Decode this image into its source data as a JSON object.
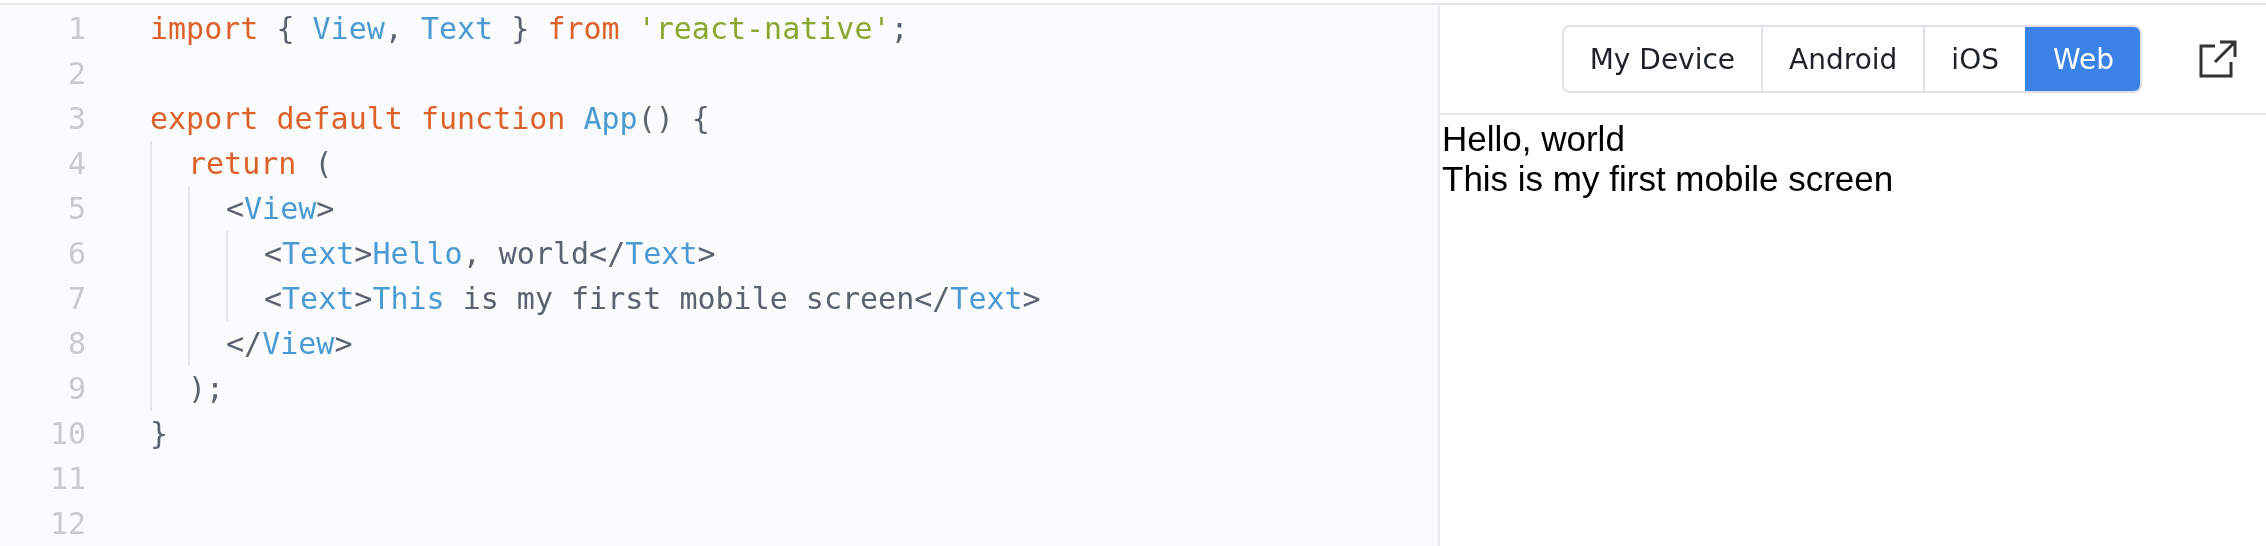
{
  "editor": {
    "lines": [
      {
        "number": "1",
        "tokens": [
          {
            "kind": "keyword",
            "text": "import"
          },
          {
            "kind": "plain",
            "text": " { "
          },
          {
            "kind": "ident",
            "text": "View"
          },
          {
            "kind": "plain",
            "text": ", "
          },
          {
            "kind": "ident",
            "text": "Text"
          },
          {
            "kind": "plain",
            "text": " } "
          },
          {
            "kind": "keyword",
            "text": "from "
          },
          {
            "kind": "string",
            "text": "'react-native'"
          },
          {
            "kind": "plain",
            "text": ";"
          }
        ]
      },
      {
        "number": "2"
      },
      {
        "number": "3",
        "tokens": [
          {
            "kind": "keyword",
            "text": "export default function "
          },
          {
            "kind": "ident",
            "text": "App"
          },
          {
            "kind": "plain",
            "text": "() {"
          }
        ],
        "children": [
          {
            "number": "4",
            "tokens": [
              {
                "kind": "keyword",
                "text": "return"
              },
              {
                "kind": "plain",
                "text": " ("
              }
            ],
            "children": [
              {
                "number": "5",
                "tokens": [
                  {
                    "kind": "plain",
                    "text": "<"
                  },
                  {
                    "kind": "ident",
                    "text": "View"
                  },
                  {
                    "kind": "plain",
                    "text": ">"
                  }
                ],
                "children": [
                  {
                    "number": "6",
                    "tokens": [
                      {
                        "kind": "plain",
                        "text": "<"
                      },
                      {
                        "kind": "ident",
                        "text": "Text"
                      },
                      {
                        "kind": "plain",
                        "text": ">"
                      },
                      {
                        "kind": "ident",
                        "text": "Hello"
                      },
                      {
                        "kind": "plain",
                        "text": ", world</"
                      },
                      {
                        "kind": "ident",
                        "text": "Text"
                      },
                      {
                        "kind": "plain",
                        "text": ">"
                      }
                    ]
                  },
                  {
                    "number": "7",
                    "tokens": [
                      {
                        "kind": "plain",
                        "text": "<"
                      },
                      {
                        "kind": "ident",
                        "text": "Text"
                      },
                      {
                        "kind": "plain",
                        "text": ">"
                      },
                      {
                        "kind": "ident",
                        "text": "This"
                      },
                      {
                        "kind": "plain",
                        "text": " is my first mobile screen</"
                      },
                      {
                        "kind": "ident",
                        "text": "Text"
                      },
                      {
                        "kind": "plain",
                        "text": ">"
                      }
                    ]
                  }
                ]
              },
              {
                "number": "8",
                "tokens": [
                  {
                    "kind": "plain",
                    "text": "</"
                  },
                  {
                    "kind": "ident",
                    "text": "View"
                  },
                  {
                    "kind": "plain",
                    "text": ">"
                  }
                ]
              }
            ]
          },
          {
            "number": "9",
            "tokens": [
              {
                "kind": "plain",
                "text": ");"
              }
            ]
          }
        ]
      },
      {
        "number": "10",
        "tokens": [
          {
            "kind": "plain",
            "text": "}"
          }
        ]
      },
      {
        "number": "11"
      },
      {
        "number": "12"
      }
    ]
  },
  "preview": {
    "platforms": [
      {
        "label": "My Device",
        "selected": false
      },
      {
        "label": "Android",
        "selected": false
      },
      {
        "label": "iOS",
        "selected": false
      },
      {
        "label": "Web",
        "selected": true
      }
    ],
    "output_lines": [
      "Hello, world",
      "This is my first mobile screen"
    ]
  }
}
